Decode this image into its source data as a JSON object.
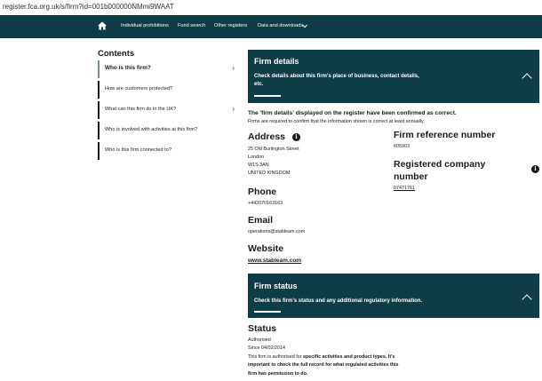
{
  "browser": {
    "url": "register.fca.org.uk/s/firm?id=001b000000NMmi9WAAT"
  },
  "nav": {
    "home_icon": "home-icon",
    "items": [
      "Individual prohibitions",
      "Fund search",
      "Other registers",
      "Data and downloads"
    ],
    "dropdown_icon": "chevron-down-icon"
  },
  "contents": {
    "title": "Contents",
    "items": [
      "Who is this firm?",
      "How are customers protected?",
      "What can this firm do in the UK?",
      "Who is involved with activities at this firm?",
      "Who is this firm connected to?"
    ]
  },
  "firm_details": {
    "title": "Firm details",
    "desc_line1": "Check details about this firm's place of business, contact details,",
    "desc_line2": "etc.",
    "confirmed": "The 'firm details' displayed on the register have been confirmed as correct.",
    "confirm_note": "Firms are required to confirm that the information shown is correct at least annually.",
    "address_heading": "Address",
    "address_lines": [
      "25 Old Burlington Street",
      "London",
      "W1S 3AN",
      "UNITED KINGDOM"
    ],
    "phone_heading": "Phone",
    "phone": "+442070163163",
    "email_heading": "Email",
    "email": "operations@stableam.com",
    "website_heading": "Website",
    "website": "www.stableam.com",
    "frn_heading": "Firm reference number",
    "frn": "605903",
    "reg_heading_line1": "Registered company",
    "reg_heading_line2": "number",
    "reg_number": "07471761"
  },
  "firm_status": {
    "title": "Firm status",
    "desc": "Check this firm's status and any additional regulatory information.",
    "status_heading": "Status",
    "status": "Authorised",
    "since": "Since 04/02/2014",
    "para_1": "This firm is authorised for ",
    "para_bold_1": "specific activities and product types.",
    "para_bold_2": " It's important to check the full record for what regulated activities this firm has permission to do."
  },
  "colors": {
    "brand_teal": "#0e3d47",
    "text": "#1a1a1a"
  }
}
